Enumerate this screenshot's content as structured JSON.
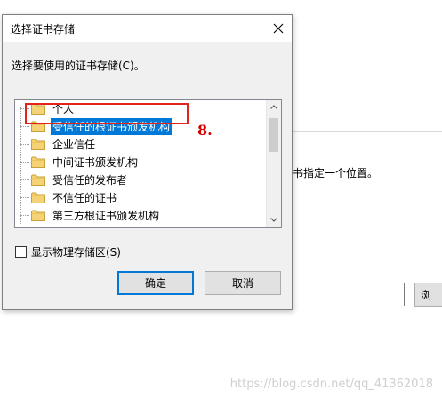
{
  "dialog": {
    "title": "选择证书存储",
    "prompt": "选择要使用的证书存储(C)。",
    "tree": {
      "items": [
        {
          "label": "个人",
          "selected": false
        },
        {
          "label": "受信任的根证书颁发机构",
          "selected": true
        },
        {
          "label": "企业信任",
          "selected": false
        },
        {
          "label": "中间证书颁发机构",
          "selected": false
        },
        {
          "label": "受信任的发布者",
          "selected": false
        },
        {
          "label": "不信任的证书",
          "selected": false
        },
        {
          "label": "第三方根证书颁发机构",
          "selected": false
        }
      ]
    },
    "checkbox": {
      "label": "显示物理存储区(S)",
      "checked": false
    },
    "ok_label": "确定",
    "cancel_label": "取消"
  },
  "annotation": "8.",
  "background": {
    "partial_text": "书指定一个位置。",
    "browse_label": "浏"
  },
  "watermark": "https://blog.csdn.net/qq_41362018",
  "colors": {
    "selection": "#0078d7",
    "annotation_red": "#e0241b",
    "folder": "#f5d276"
  },
  "icons": {
    "close": "close-icon",
    "folder": "folder-icon",
    "scroll_up": "chevron-up-icon",
    "scroll_down": "chevron-down-icon"
  }
}
